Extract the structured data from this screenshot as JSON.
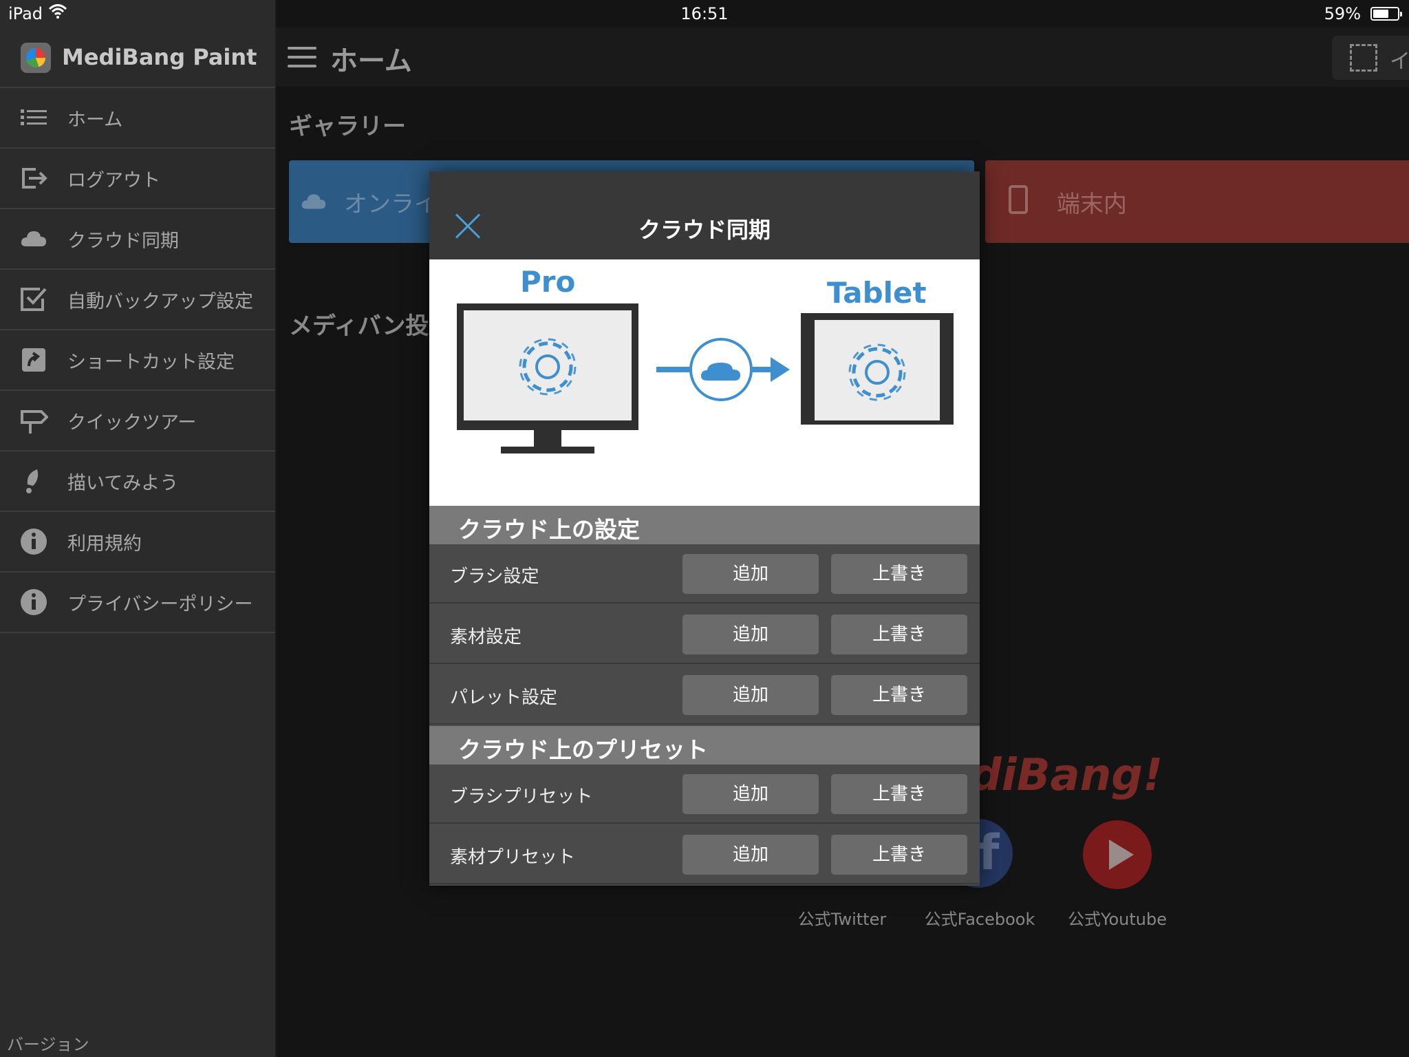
{
  "status_bar": {
    "device": "iPad",
    "time": "16:51",
    "battery": "59%"
  },
  "sidebar": {
    "app_title": "MediBang Paint",
    "items": [
      {
        "label": "ホーム",
        "icon": "list-icon"
      },
      {
        "label": "ログアウト",
        "icon": "logout-icon"
      },
      {
        "label": "クラウド同期",
        "icon": "cloud-icon"
      },
      {
        "label": "自動バックアップ設定",
        "icon": "checkbox-icon"
      },
      {
        "label": "ショートカット設定",
        "icon": "shortcut-icon"
      },
      {
        "label": "クイックツアー",
        "icon": "signpost-icon"
      },
      {
        "label": "描いてみよう",
        "icon": "brush-icon"
      },
      {
        "label": "利用規約",
        "icon": "info-icon"
      },
      {
        "label": "プライバシーポリシー",
        "icon": "info-icon"
      }
    ],
    "version_label": "バージョン"
  },
  "main": {
    "page_title": "ホーム",
    "image_button_label": "イ",
    "gallery_title": "ギャラリー",
    "online_tab_label": "オンライ",
    "device_tab_label": "端末内",
    "medibang_post_title": "メディバン投",
    "medibang_logo_text": "diBang!",
    "social": {
      "twitter": "公式Twitter",
      "facebook": "公式Facebook",
      "youtube": "公式Youtube"
    }
  },
  "modal": {
    "title": "クラウド同期",
    "diagram": {
      "left_label": "Pro",
      "right_label": "Tablet"
    },
    "sections": [
      {
        "title": "クラウド上の設定",
        "rows": [
          {
            "label": "ブラシ設定",
            "add": "追加",
            "overwrite": "上書き"
          },
          {
            "label": "素材設定",
            "add": "追加",
            "overwrite": "上書き"
          },
          {
            "label": "パレット設定",
            "add": "追加",
            "overwrite": "上書き"
          }
        ]
      },
      {
        "title": "クラウド上のプリセット",
        "rows": [
          {
            "label": "ブラシプリセット",
            "add": "追加",
            "overwrite": "上書き"
          },
          {
            "label": "素材プリセット",
            "add": "追加",
            "overwrite": "上書き"
          }
        ]
      }
    ]
  },
  "colors": {
    "accent_blue": "#3d8fd0",
    "online_tab": "#2b5a84",
    "device_tab": "#6e2a26",
    "sidebar_bg": "#2b2b2b"
  }
}
